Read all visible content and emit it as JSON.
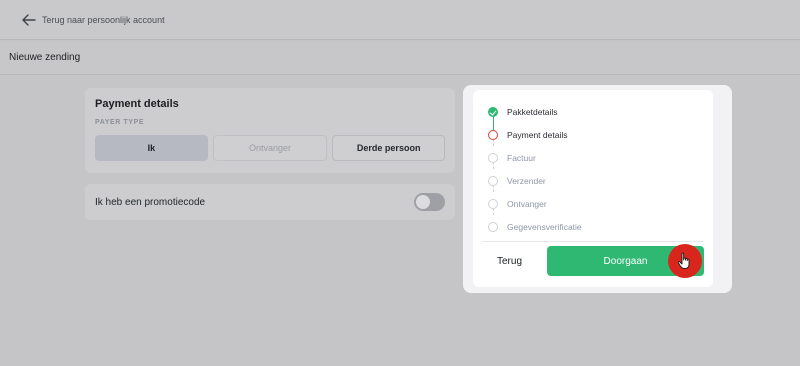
{
  "topbar": {
    "back_label": "Terug naar persoonlijk account",
    "back_icon": "arrow-left-icon"
  },
  "page": {
    "title": "Nieuwe zending"
  },
  "payment": {
    "title": "Payment details",
    "payer_type_label": "PAYER TYPE",
    "options": [
      {
        "label": "Ik",
        "state": "selected"
      },
      {
        "label": "Ontvanger",
        "state": "disabled"
      },
      {
        "label": "Derde persoon",
        "state": "default"
      }
    ]
  },
  "promo": {
    "label": "Ik heb een promotiecode",
    "toggle_on": false
  },
  "stepper": {
    "steps": [
      {
        "label": "Pakketdetails",
        "status": "done"
      },
      {
        "label": "Payment details",
        "status": "current"
      },
      {
        "label": "Factuur",
        "status": "todo"
      },
      {
        "label": "Verzender",
        "status": "todo"
      },
      {
        "label": "Ontvanger",
        "status": "todo"
      },
      {
        "label": "Gegevensverificatie",
        "status": "todo"
      }
    ],
    "back_label": "Terug",
    "continue_label": "Doorgaan"
  },
  "colors": {
    "accent_green": "#2eb872",
    "current_red": "#e0403a",
    "cursor_red": "#d9261c"
  },
  "cursor_icon": "hand-pointer-icon"
}
